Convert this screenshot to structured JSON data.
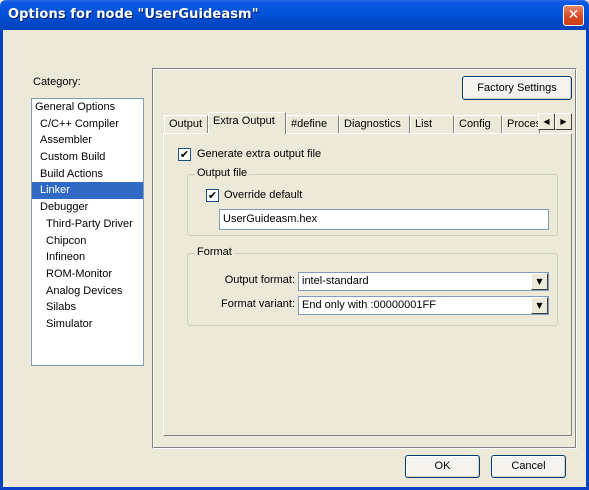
{
  "window": {
    "title": "Options for node \"UserGuideasm\"",
    "close_glyph": "✕"
  },
  "category": {
    "label": "Category:",
    "items": [
      {
        "label": "General Options"
      },
      {
        "label": "C/C++ Compiler"
      },
      {
        "label": "Assembler"
      },
      {
        "label": "Custom Build"
      },
      {
        "label": "Build Actions"
      },
      {
        "label": "Linker"
      },
      {
        "label": "Debugger"
      },
      {
        "label": "Third-Party Driver"
      },
      {
        "label": "Chipcon"
      },
      {
        "label": "Infineon"
      },
      {
        "label": "ROM-Monitor"
      },
      {
        "label": "Analog Devices"
      },
      {
        "label": "Silabs"
      },
      {
        "label": "Simulator"
      }
    ],
    "selected": "Linker"
  },
  "factory_settings_label": "Factory Settings",
  "tabs": [
    {
      "label": "Output"
    },
    {
      "label": "Extra Output"
    },
    {
      "label": "#define"
    },
    {
      "label": "Diagnostics"
    },
    {
      "label": "List"
    },
    {
      "label": "Config"
    },
    {
      "label": "Proces"
    }
  ],
  "active_tab": "Extra Output",
  "tab_scroll": {
    "left_glyph": "◀",
    "right_glyph": "▶"
  },
  "extra_output": {
    "generate_label": "Generate extra output file",
    "generate_checked": true,
    "output_file_group": "Output file",
    "override_label": "Override default",
    "override_checked": true,
    "filename": "UserGuideasm.hex",
    "format_group": "Format",
    "output_format_label": "Output format:",
    "output_format_value": "intel-standard",
    "format_variant_label": "Format variant:",
    "format_variant_value": "End only with :00000001FF"
  },
  "buttons": {
    "ok": "OK",
    "cancel": "Cancel"
  },
  "check_glyph": "✔",
  "dropdown_glyph": "▼",
  "colors": {
    "selection": "#316AC5",
    "titlebar": "#0453D9",
    "close": "#D6461F"
  }
}
